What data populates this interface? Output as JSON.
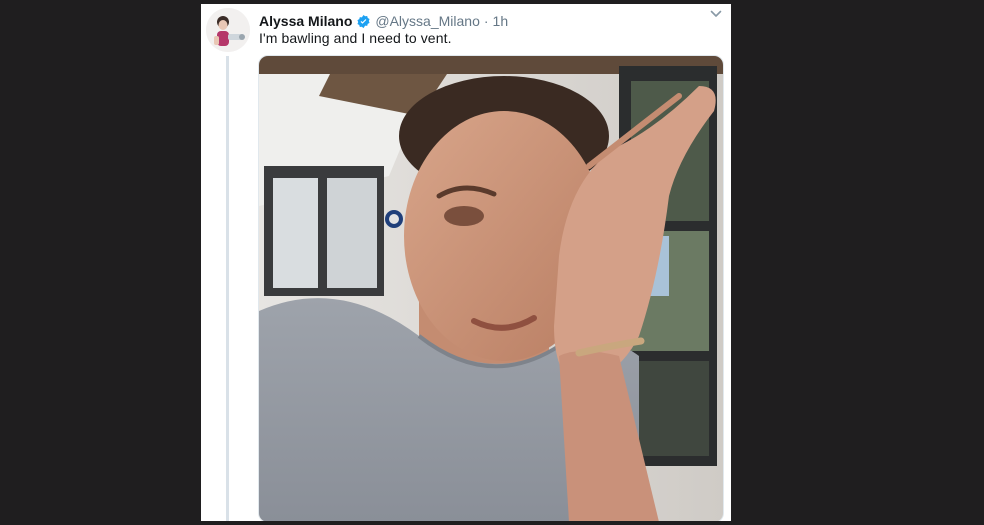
{
  "tweet": {
    "display_name": "Alyssa Milano",
    "handle": "@Alyssa_Milano",
    "separator": "·",
    "time": "1h",
    "text": "I'm bawling and I need to vent.",
    "verified": true,
    "icons": {
      "verified": "verified-badge-icon",
      "more": "chevron-down-icon"
    },
    "colors": {
      "name": "#14171a",
      "meta": "#657786",
      "verified": "#1da1f2",
      "page_background": "#1f1e1f"
    }
  }
}
